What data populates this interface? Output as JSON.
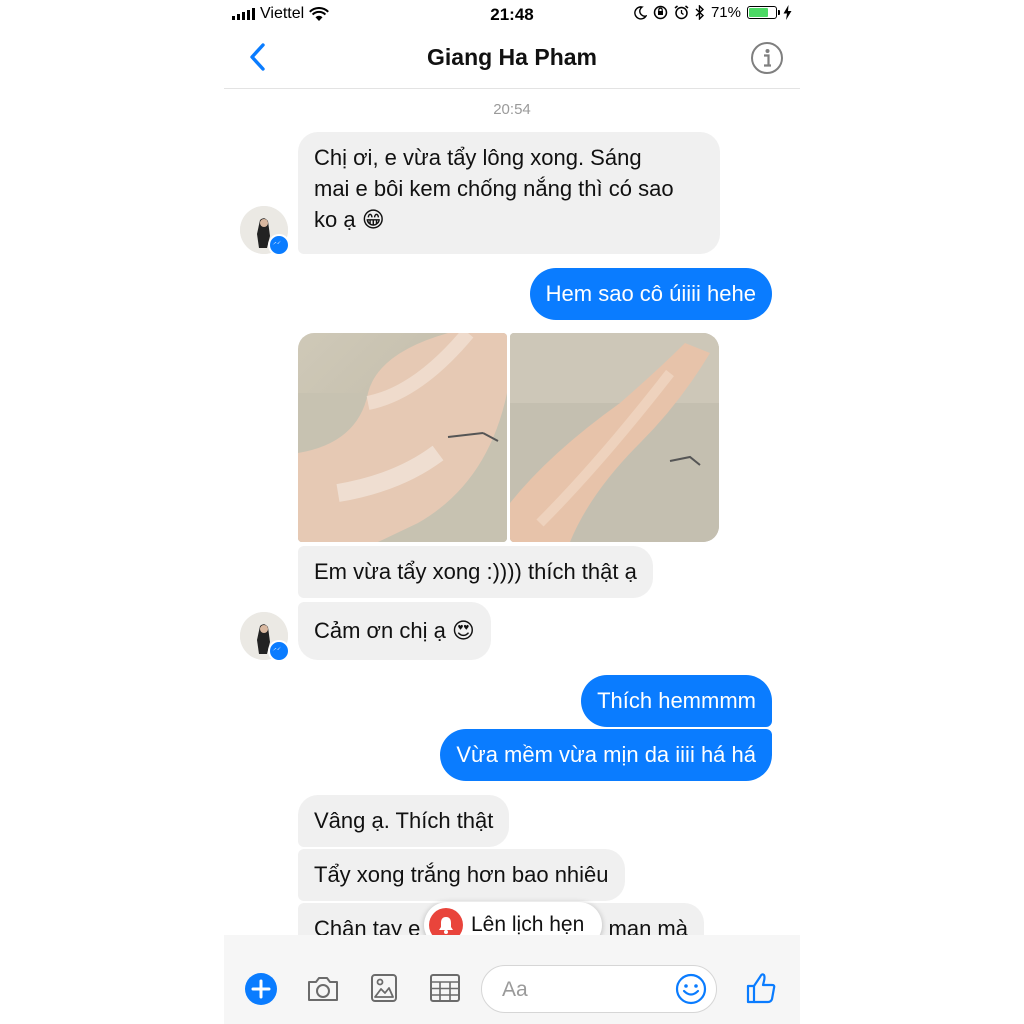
{
  "status_bar": {
    "carrier": "Viettel",
    "time": "21:48",
    "battery": "71%",
    "battery_level": 0.71
  },
  "header": {
    "contact_name": "Giang Ha Pham"
  },
  "conversation": {
    "timestamp": "20:54",
    "messages": [
      {
        "from": "contact",
        "lines": [
          "Chị ơi, e vừa tẩy lông xong. Sáng",
          "mai e bôi kem chống nắng thì có sao",
          "ko ạ 😁"
        ]
      },
      {
        "from": "me",
        "text": "Hem sao cô úiiii hehe"
      },
      {
        "from": "contact",
        "type": "photos",
        "count": 2
      },
      {
        "from": "contact",
        "text": "Em vừa tẩy xong :)))) thích thật ạ"
      },
      {
        "from": "contact",
        "text": "Cảm ơn chị ạ 😍"
      },
      {
        "from": "me",
        "text": "Thích hemmmm"
      },
      {
        "from": "me",
        "text": "Vừa mềm vừa mịn da iiii há há"
      },
      {
        "from": "contact",
        "text": "Vâng ạ. Thích thật"
      },
      {
        "from": "contact",
        "text": "Tẩy xong trắng hơn bao nhiêu"
      },
      {
        "from": "contact",
        "text": "Chân tay e",
        "text_tail": "man mà"
      }
    ]
  },
  "toast": {
    "label": "Lên lịch hẹn"
  },
  "composer": {
    "placeholder": "Aa",
    "value": ""
  },
  "colors": {
    "accent": "#0a7cff",
    "incoming_bubble": "#f0f0f0",
    "toast_bell": "#e9443b",
    "battery_fill": "#4cd964"
  },
  "icons": [
    "back-chevron-icon",
    "info-icon",
    "plus-icon",
    "camera-icon",
    "gallery-icon",
    "grid-icon",
    "emoji-icon",
    "thumbs-up-icon",
    "bell-icon",
    "messenger-badge-icon",
    "wifi-icon",
    "moon-icon",
    "alarm-icon",
    "bluetooth-icon",
    "charging-icon"
  ]
}
